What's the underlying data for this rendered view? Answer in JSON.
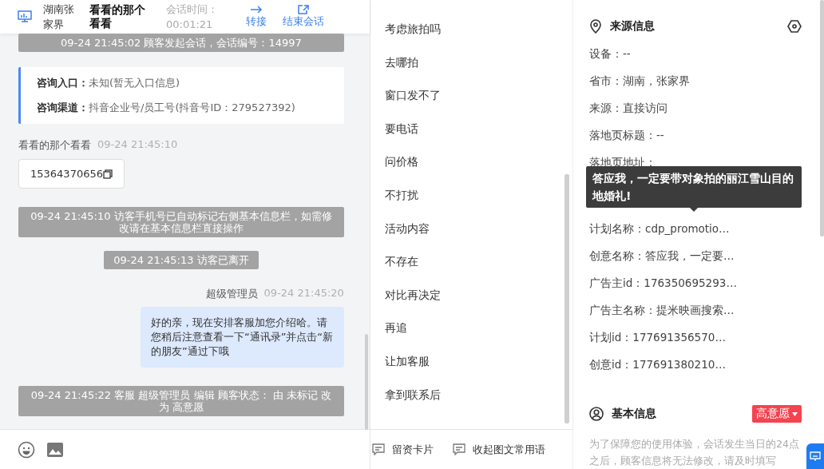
{
  "header": {
    "location": "湖南张家界",
    "visitor": "看看的那个看看",
    "duration_label": "会话时间：",
    "duration": "00:01:21",
    "actions": [
      {
        "label": "转接",
        "kind": "transfer"
      },
      {
        "label": "结束会话",
        "kind": "end"
      }
    ]
  },
  "messages": [
    {
      "kind": "system",
      "text": "09-24 21:45:02 顾客发起会话，会话编号：14997"
    },
    {
      "kind": "info_card",
      "rows": [
        {
          "label": "咨询入口：",
          "value": "未知(暂无入口信息)"
        },
        {
          "label": "咨询渠道：",
          "value": "抖音企业号/员工号(抖音号ID：279527392)"
        }
      ]
    },
    {
      "kind": "visitor",
      "sender": "看看的那个看看",
      "time": "09-24 21:45:10",
      "text": "15364370656"
    },
    {
      "kind": "system",
      "text": "09-24 21:45:10 访客手机号已自动标记右侧基本信息栏，如需修改请在基本信息栏直接操作"
    },
    {
      "kind": "system",
      "text": "09-24 21:45:13 访客已离开"
    },
    {
      "kind": "agent",
      "sender": "超级管理员",
      "time": "09-24 21:45:20",
      "text": "好的亲，现在安排客服加您介绍哈。请您稍后注意查看一下“通讯录”并点击“新的朋友”通过下哦"
    },
    {
      "kind": "system",
      "text": "09-24 21:45:22 客服 超级管理员 编辑 顾客状态： 由 未标记 改为 高意愿"
    }
  ],
  "quick_replies": [
    "考虑旅拍吗",
    "去哪拍",
    "窗口发不了",
    "要电话",
    "问价格",
    "不打扰",
    "活动内容",
    "不存在",
    "对比再决定",
    "再追",
    "让加客服",
    "拿到联系后"
  ],
  "quick_footer": [
    {
      "label": "留资卡片"
    },
    {
      "label": "收起图文常用语"
    }
  ],
  "source_info": {
    "title": "来源信息",
    "rows": [
      "设备：--",
      "省市：湖南，张家界",
      "来源：直接访问",
      "落地页标题：--",
      "落地页地址：",
      "计划名称：cdp_promotio…",
      "创意名称：答应我，一定要…",
      "广告主id：176350695293…",
      "广告主名称：提米映画搜索…",
      "计划id：177691356570…",
      "创意id：177691380210…"
    ],
    "tooltip": {
      "text": "答应我，一定要带对象拍的丽江雪山目的地婚礼!"
    }
  },
  "basic_info": {
    "title": "基本信息",
    "status": {
      "label": "高意愿",
      "color": "#f5434f"
    },
    "notice": "为了保障您的使用体验，会话发生当日的24点之后，顾客信息将无法修改，请及时填写"
  }
}
